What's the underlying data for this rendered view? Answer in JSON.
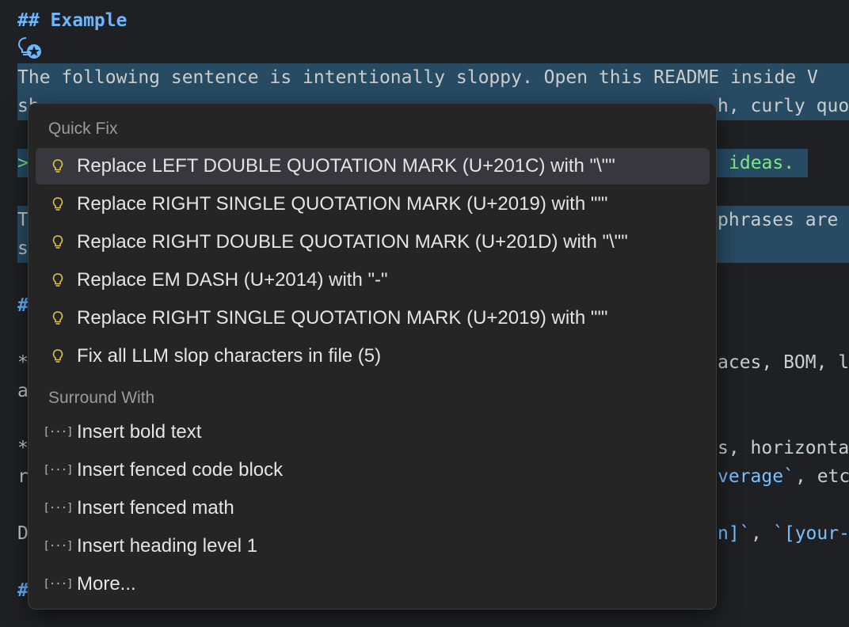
{
  "editor": {
    "heading_example": "## Example",
    "line_1": "The following sentence is intentionally sloppy. Open this README inside V",
    "line_2a": "sh",
    "line_2b": "h, curly quo",
    "line_3a": ">",
    "line_3b": "ideas.",
    "line_4a": "T",
    "line_4b": "phrases are",
    "line_5a": "s",
    "line_6a": "#",
    "line_7a": "*",
    "line_7b": "aces, BOM, l",
    "line_8a": "a",
    "line_9a": "*",
    "line_9b": "s, horizonta",
    "line_10a": "r",
    "line_10b_code": "verage`",
    "line_10c": ", etc",
    "line_11a": "D",
    "line_11b_code": "n]`",
    "line_11c": ", ",
    "line_11d_code": "`[your-",
    "line_12a": "#"
  },
  "quick_fix_menu": {
    "section_quick_fix": "Quick Fix",
    "section_surround_with": "Surround With",
    "quick_fix_items": [
      {
        "label": "Replace LEFT DOUBLE QUOTATION MARK (U+201C) with \"\\\"\"",
        "icon": "lightbulb-icon"
      },
      {
        "label": "Replace RIGHT SINGLE QUOTATION MARK (U+2019) with \"'\"",
        "icon": "lightbulb-icon"
      },
      {
        "label": "Replace RIGHT DOUBLE QUOTATION MARK (U+201D) with \"\\\"\"",
        "icon": "lightbulb-icon"
      },
      {
        "label": "Replace EM DASH (U+2014) with \"-\"",
        "icon": "lightbulb-icon"
      },
      {
        "label": "Replace RIGHT SINGLE QUOTATION MARK (U+2019) with \"'\"",
        "icon": "lightbulb-icon"
      },
      {
        "label": "Fix all LLM slop characters in file (5)",
        "icon": "lightbulb-icon"
      }
    ],
    "surround_items": [
      {
        "label": "Insert bold text",
        "icon": "snippet-icon"
      },
      {
        "label": "Insert fenced code block",
        "icon": "snippet-icon"
      },
      {
        "label": "Insert fenced math",
        "icon": "snippet-icon"
      },
      {
        "label": "Insert heading level 1",
        "icon": "snippet-icon"
      },
      {
        "label": "More...",
        "icon": "snippet-icon"
      }
    ]
  },
  "colors": {
    "editor_bg": "#1f2023",
    "menu_bg": "#252526",
    "selection_bg": "#264b63",
    "heading": "#6cb6ff",
    "lightbulb": "#e2c04a"
  }
}
